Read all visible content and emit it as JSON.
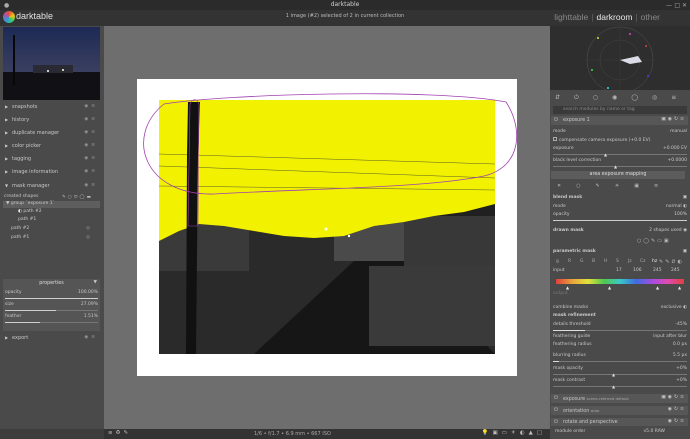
{
  "window": {
    "title": "darktable"
  },
  "header": {
    "app_name": "darktable",
    "collection_info": "1 image (#2) selected of 2 in current collection",
    "views": [
      "lighttable",
      "darkroom",
      "other"
    ]
  },
  "left_panel": {
    "modules": [
      {
        "label": "snapshots"
      },
      {
        "label": "history"
      },
      {
        "label": "duplicate manager"
      },
      {
        "label": "color picker"
      },
      {
        "label": "tagging"
      },
      {
        "label": "image information"
      },
      {
        "label": "mask manager"
      }
    ],
    "created_shapes_label": "created shapes",
    "shapes_tree": [
      {
        "label": "group `exposure 1`"
      },
      {
        "label": "path #2"
      },
      {
        "label": "path #1"
      },
      {
        "label": "path #2"
      },
      {
        "label": "path #1"
      }
    ],
    "properties": {
      "title": "properties",
      "rows": [
        {
          "label": "opacity",
          "value": "100.00%",
          "level": 1.0
        },
        {
          "label": "size",
          "value": "27.09%",
          "level": 0.55
        },
        {
          "label": "feather",
          "value": "1.51%",
          "level": 0.38
        }
      ]
    },
    "export_label": "export"
  },
  "bottom_bar": {
    "exif": "1/6 • f/1.7 • 6.9 mm • 667 ISO"
  },
  "right_panel": {
    "search_placeholder": "search modules by name or tag",
    "exposure_module": {
      "title": "exposure 1",
      "rows": [
        {
          "label": "mode",
          "value": "manual"
        },
        {
          "label": "compensate camera exposure (+0.0 EV)",
          "value": ""
        },
        {
          "label": "exposure",
          "value": "+0.000 EV"
        },
        {
          "label": "black level correction",
          "value": "+0.0000"
        }
      ],
      "section_tab": "area exposure mapping"
    },
    "blend": {
      "blend_mask_label": "blend mask",
      "mode_label": "mode",
      "mode_value": "normal",
      "opacity_label": "opacity",
      "opacity_value": "100%",
      "drawn_mask_label": "drawn mask",
      "drawn_mask_value": "2 shapes used",
      "parametric_mask_label": "parametric mask",
      "channels": [
        "g",
        "R",
        "G",
        "B",
        "H",
        "S",
        "Jz",
        "Cz",
        "hz"
      ],
      "input_label": "input",
      "input_values": [
        "17",
        "106",
        "245",
        "245"
      ],
      "output_label": "output",
      "combine_label": "combine masks",
      "combine_value": "exclusive",
      "refinement_title": "mask refinement",
      "refinement_rows": [
        {
          "label": "details threshold",
          "value": "-45%"
        },
        {
          "label": "feathering guide",
          "value": "input after blur"
        },
        {
          "label": "feathering radius",
          "value": "0.0 px"
        },
        {
          "label": "blurring radius",
          "value": "5.5 px"
        },
        {
          "label": "mask opacity",
          "value": "+0%"
        },
        {
          "label": "mask contrast",
          "value": "+0%"
        }
      ]
    },
    "collapsed_modules": [
      {
        "label": "exposure",
        "sub": "scene-referred default"
      },
      {
        "label": "orientation",
        "sub": "auto"
      },
      {
        "label": "rotate and perspective",
        "sub": ""
      }
    ],
    "module_order_label": "module order",
    "module_order_value": "v5.0 RAW"
  },
  "colors": {
    "mask_overlay": "#f2f200",
    "path_stroke": "#a040b0"
  }
}
